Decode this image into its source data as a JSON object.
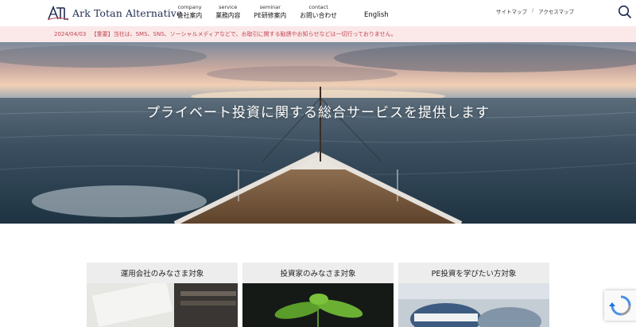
{
  "brand": {
    "name": "Ark Totan Alternative",
    "logo_icon": "atl-logo-icon"
  },
  "nav": {
    "items": [
      {
        "en": "company",
        "jp": "会社案内"
      },
      {
        "en": "service",
        "jp": "業務内容"
      },
      {
        "en": "seminar",
        "jp": "PE研修案内"
      },
      {
        "en": "contact",
        "jp": "お問い合わせ"
      }
    ],
    "english": "English"
  },
  "util": {
    "sitemap": "サイトマップ",
    "separator": "/",
    "access": "アクセスマップ"
  },
  "search": {
    "icon": "search-icon"
  },
  "notice": {
    "date": "2024/04/03",
    "text": "【重要】当社は、SMS、SNS、ソーシャルメディアなどで、お取引に関する勧誘やお知らせなどは一切行っておりません。"
  },
  "hero": {
    "title": "プライベート投資に関する総合サービスを提供します"
  },
  "cards": [
    {
      "label": "運用会社のみなさま対象"
    },
    {
      "label": "投資家のみなさま対象"
    },
    {
      "label": "PE投資を学びたい方対象"
    }
  ],
  "colors": {
    "notice_bg": "#fbe9ea",
    "notice_text": "#c0454f",
    "brand_navy": "#1f2d4f",
    "card_header": "#ededed"
  }
}
